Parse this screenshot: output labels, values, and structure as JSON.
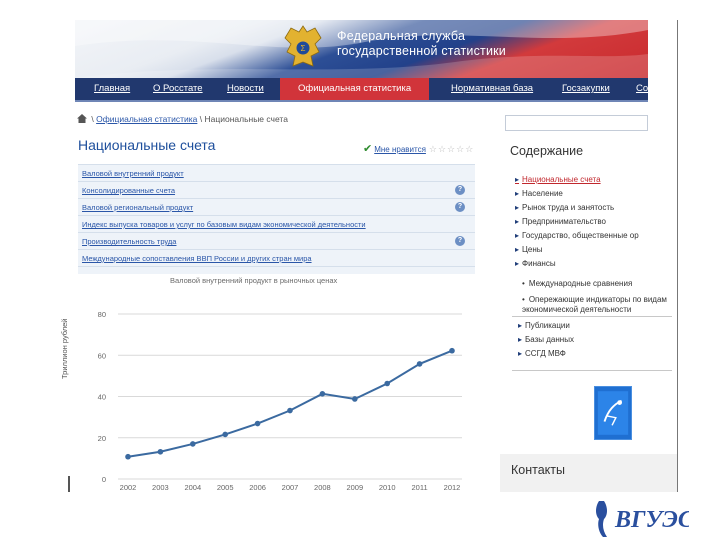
{
  "header": {
    "org_line1": "Федеральная служба",
    "org_line2": "государственной статистики"
  },
  "menu": {
    "items": [
      "Главная",
      "О Росстате",
      "Новости",
      "Официальная статистика",
      "Нормативная база",
      "Госзакупки",
      "Со"
    ],
    "active_index": 3
  },
  "breadcrumb": {
    "separator_start": "\\",
    "link": "Официальная статистика",
    "separator": "\\",
    "current": "Национальные счета"
  },
  "page": {
    "title": "Национальные счета",
    "like_label": "Мне нравится",
    "stars": "☆☆☆☆☆"
  },
  "accounts": [
    {
      "label": "Валовой внутренний продукт",
      "help": false
    },
    {
      "label": "Консолидированные счета",
      "help": true
    },
    {
      "label": "Валовой региональный продукт",
      "help": true
    },
    {
      "label": "Индекс выпуска товаров и услуг по базовым видам экономической деятельности",
      "help": false
    },
    {
      "label": "Производительность труда",
      "help": true
    },
    {
      "label": "Международные сопоставления ВВП России и других стран мира",
      "help": false
    }
  ],
  "help_glyph": "?",
  "sidebar": {
    "heading": "Содержание",
    "items": [
      "Национальные счета",
      "Население",
      "Рынок труда и занятость",
      "Предпринимательство",
      "Государство, общественные ор",
      "Цены",
      "Финансы"
    ],
    "selected_index": 0
  },
  "sidebar_continued": {
    "sub_items": [
      "Международные сравнения",
      "Опережающие индикаторы по видам экономической деятельности"
    ],
    "arrow_items": [
      "Публикации",
      "Базы данных",
      "ССГД МВФ"
    ],
    "contacts_heading": "Контакты"
  },
  "icons": {
    "home": "home-icon",
    "check": "check-icon",
    "help": "help-icon",
    "emblem": "double-headed-eagle-emblem-icon",
    "imf": "imf-logo-icon"
  },
  "colors": {
    "menu_bg": "#21386e",
    "menu_active": "#d1343a",
    "link": "#2a56a8",
    "title": "#1e4f9c",
    "selected_item": "#c1272d",
    "series": "#3b6aa0"
  },
  "chart_data": {
    "type": "line",
    "title": "Валовой внутренний продукт в рыночных ценах",
    "xlabel": "",
    "ylabel": "Триллион рублей",
    "categories": [
      "2002",
      "2003",
      "2004",
      "2005",
      "2006",
      "2007",
      "2008",
      "2009",
      "2010",
      "2011",
      "2012"
    ],
    "series": [
      {
        "values": [
          10.8,
          13.2,
          17.0,
          21.6,
          26.9,
          33.2,
          41.3,
          38.8,
          46.3,
          55.8,
          62.2
        ]
      }
    ],
    "ylim": [
      0,
      80
    ],
    "yticks": [
      0,
      20,
      40,
      60,
      80
    ],
    "grid": true,
    "legend": "none"
  },
  "footer_logo_text": "ВГУЭС"
}
